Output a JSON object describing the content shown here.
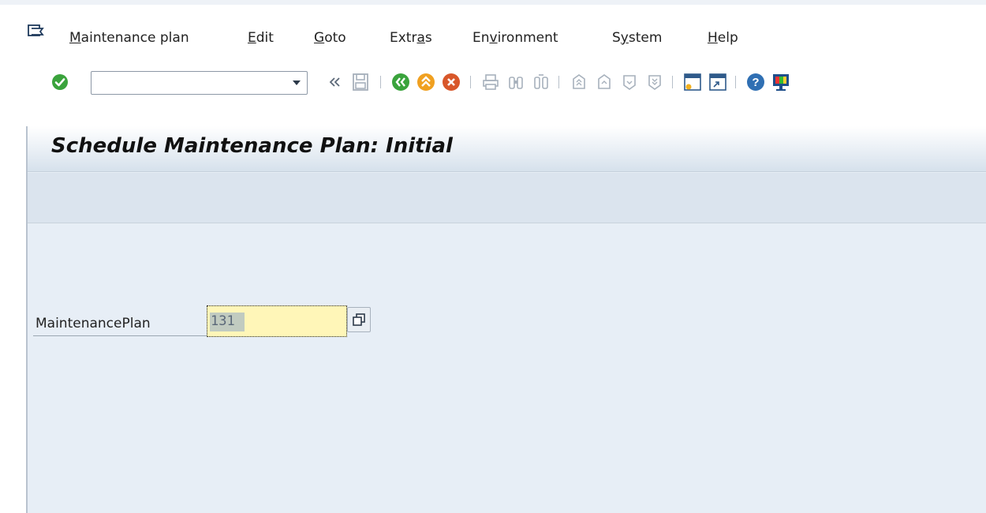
{
  "menubar": {
    "items": [
      {
        "label": "Maintenance plan",
        "underline": "M",
        "rest": "aintenance plan"
      },
      {
        "label": "Edit",
        "underline": "E",
        "rest": "dit"
      },
      {
        "label": "Goto",
        "underline": "G",
        "rest": "oto"
      },
      {
        "label": "Extras",
        "pre": "Extr",
        "underline": "a",
        "rest": "s"
      },
      {
        "label": "Environment",
        "pre": "En",
        "underline": "v",
        "rest": "ironment"
      },
      {
        "label": "System",
        "pre": "S",
        "underline": "y",
        "rest": "stem"
      },
      {
        "label": "Help",
        "underline": "H",
        "rest": "elp"
      }
    ]
  },
  "toolbar": {
    "command_field": {
      "value": "",
      "placeholder": ""
    },
    "icons": [
      "enter-icon",
      "back-double-chevron-icon",
      "save-icon",
      "back-icon",
      "exit-icon",
      "cancel-icon",
      "print-icon",
      "find-icon",
      "find-next-icon",
      "first-page-icon",
      "previous-page-icon",
      "next-page-icon",
      "last-page-icon",
      "new-session-icon",
      "shortcut-icon",
      "help-icon",
      "customize-layout-icon"
    ]
  },
  "page": {
    "title": "Schedule Maintenance Plan: Initial"
  },
  "form": {
    "maintenance_plan": {
      "label": "MaintenancePlan",
      "value": "131"
    }
  },
  "colors": {
    "accent_green": "#3aa33c",
    "orange": "#f0a020",
    "red_orange": "#d8572a",
    "input_yellow": "#fff6b8",
    "workarea_bg": "#e7eef6"
  }
}
